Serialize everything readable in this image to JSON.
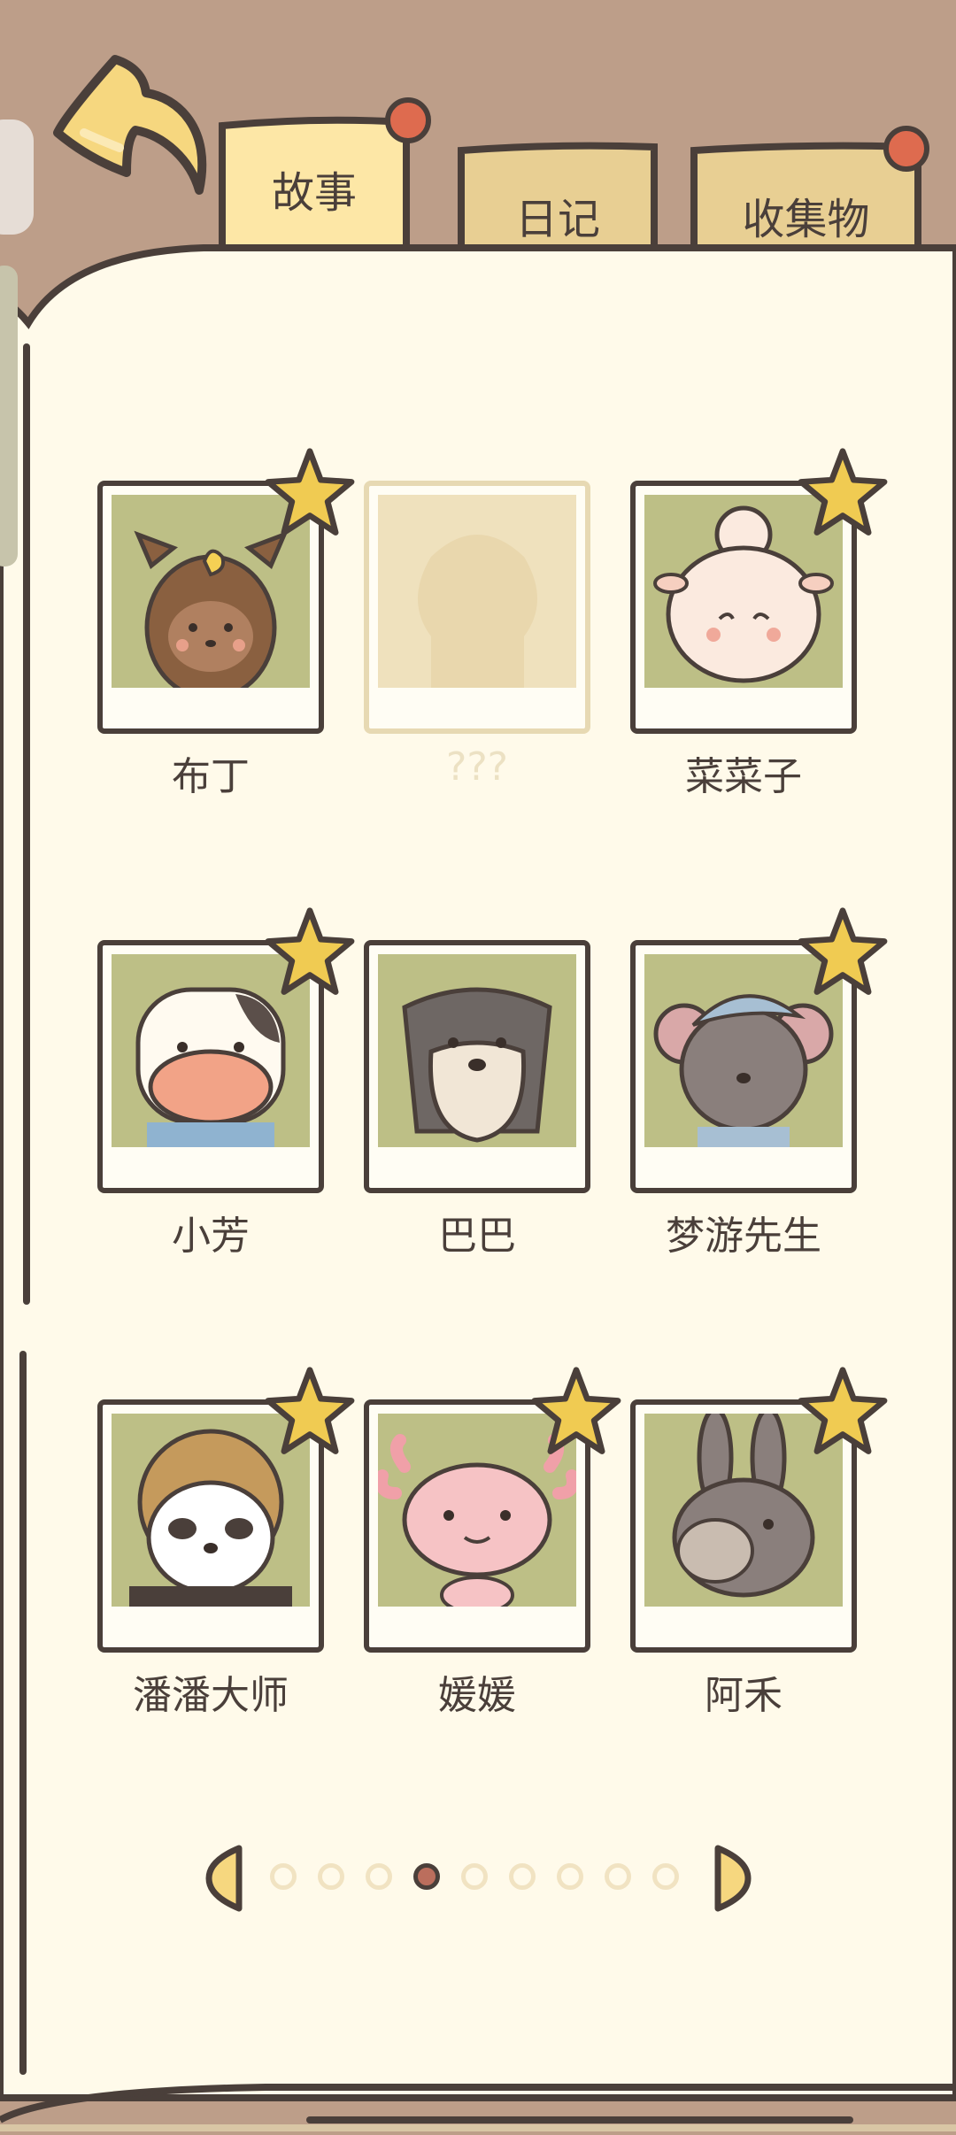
{
  "tabs": [
    {
      "label": "故事",
      "active": true,
      "badge": true
    },
    {
      "label": "日记",
      "active": false,
      "badge": false
    },
    {
      "label": "收集物",
      "active": false,
      "badge": true
    }
  ],
  "characters": [
    {
      "name": "布丁",
      "starred": true,
      "locked": false,
      "icon": "pomeranian-portrait-icon"
    },
    {
      "name": "???",
      "starred": false,
      "locked": true,
      "icon": "silhouette-portrait-icon"
    },
    {
      "name": "菜菜子",
      "starred": true,
      "locked": false,
      "icon": "sheep-portrait-icon"
    },
    {
      "name": "小芳",
      "starred": true,
      "locked": false,
      "icon": "cow-portrait-icon"
    },
    {
      "name": "巴巴",
      "starred": false,
      "locked": false,
      "icon": "schnauzer-portrait-icon"
    },
    {
      "name": "梦游先生",
      "starred": true,
      "locked": false,
      "icon": "mouse-portrait-icon"
    },
    {
      "name": "潘潘大师",
      "starred": true,
      "locked": false,
      "icon": "panda-portrait-icon"
    },
    {
      "name": "媛媛",
      "starred": true,
      "locked": false,
      "icon": "axolotl-portrait-icon"
    },
    {
      "name": "阿禾",
      "starred": true,
      "locked": false,
      "icon": "donkey-portrait-icon"
    }
  ],
  "pagination": {
    "total": 9,
    "current": 4
  },
  "colors": {
    "background": "#bd9e89",
    "page": "#fffaea",
    "outline": "#4a3f3a",
    "tab_active": "#fde7a6",
    "tab_inactive": "#e8cf93",
    "badge": "#de6b4f",
    "star": "#f0cb52",
    "photo": "#bdbf86"
  }
}
